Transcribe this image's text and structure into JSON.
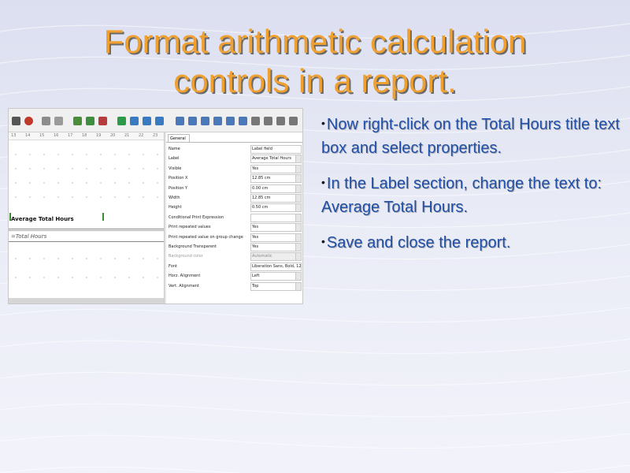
{
  "slide": {
    "title_lines": [
      "Format arithmetic calculation",
      "controls in a report."
    ]
  },
  "screenshot": {
    "ruler_ticks": [
      "13",
      "14",
      "15",
      "16",
      "17",
      "18",
      "19",
      "20",
      "21",
      "22",
      "23"
    ],
    "design": {
      "average_label": "Average Total Hours",
      "total_field": "=Total Hours"
    },
    "properties": {
      "tab": "General",
      "rows": [
        {
          "name": "Name",
          "value": "Label field"
        },
        {
          "name": "Label",
          "value": "Average Total Hours"
        },
        {
          "name": "Visible",
          "value": "Yes"
        },
        {
          "name": "Position X",
          "value": "12.85 cm"
        },
        {
          "name": "Position Y",
          "value": "0.00 cm"
        },
        {
          "name": "Width",
          "value": "12.85 cm"
        },
        {
          "name": "Height",
          "value": "0.50 cm"
        },
        {
          "name": "Conditional Print Expression",
          "value": ""
        },
        {
          "name": "Print repeated values",
          "value": "Yes"
        },
        {
          "name": "Print repeated value on group change",
          "value": "Yes"
        },
        {
          "name": "Background Transparent",
          "value": "Yes"
        },
        {
          "name": "Background color",
          "value": "Automatic"
        },
        {
          "name": "Font",
          "value": "Liberation Sans, Bold, 12"
        },
        {
          "name": "Horz. Alignment",
          "value": "Left"
        },
        {
          "name": "Vert. Alignment",
          "value": "Top"
        }
      ]
    }
  },
  "bullets": [
    "Now right-click on the Total Hours title text box and select properties.",
    "In the Label section, change the text to: Average Total Hours.",
    "Save and close the report."
  ]
}
